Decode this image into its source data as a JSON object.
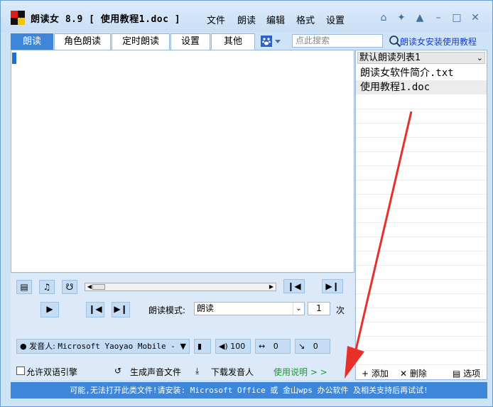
{
  "window": {
    "title": "朗读女 8.9 [ 使用教程1.doc ]",
    "menu": [
      "文件",
      "朗读",
      "编辑",
      "格式",
      "设置"
    ]
  },
  "tabs": [
    "朗读",
    "角色朗读",
    "定时朗读",
    "设置",
    "其他"
  ],
  "search": {
    "placeholder": "点此搜索"
  },
  "tutorial_link": "朗读女安装使用教程",
  "playlist": {
    "selected_list": "默认朗读列表1",
    "items": [
      "朗读女软件简介.txt",
      "使用教程1.doc"
    ],
    "actions": {
      "add": "添加",
      "delete": "删除",
      "options": "选项"
    }
  },
  "controls": {
    "mode_label": "朗读模式:",
    "mode_value": "朗读",
    "times_value": "1",
    "times_label": "次",
    "voice_label": "发音人:",
    "voice_value": "Microsoft Yaoyao Mobile -",
    "volume": "100",
    "speed": "0",
    "pitch": "0",
    "bilingual": "允许双语引擎",
    "generate_audio": "生成声音文件",
    "download_voice": "下载发音人",
    "help": "使用说明 > >"
  },
  "status": "可能,无法打开此类文件!请安装: Microsoft Office 或 金山wps 办公软件 及相关支持后再试试!",
  "colors": {
    "accent": "#3d86d9",
    "link": "#1a3cc8",
    "help": "#1a9a2a"
  }
}
